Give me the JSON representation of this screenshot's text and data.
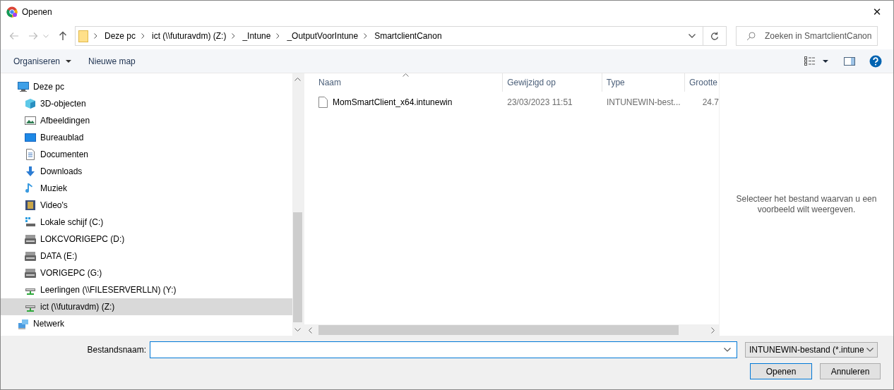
{
  "window": {
    "title": "Openen",
    "close": "✕"
  },
  "address": {
    "breadcrumbs": [
      "Deze pc",
      "ict (\\\\futuravdm) (Z:)",
      "_Intune",
      "_OutputVoorIntune",
      "SmartclientCanon"
    ]
  },
  "search": {
    "placeholder": "Zoeken in SmartclientCanon"
  },
  "toolbar": {
    "items": [
      "Organiseren",
      "Nieuwe map"
    ]
  },
  "navigation": [
    {
      "label": "Deze pc",
      "kind": "pc",
      "selected": false,
      "children": [
        {
          "label": "3D-objecten",
          "kind": "cube",
          "selected": false
        },
        {
          "label": "Afbeeldingen",
          "kind": "images",
          "selected": false
        },
        {
          "label": "Bureaublad",
          "kind": "desktop",
          "selected": false
        },
        {
          "label": "Documenten",
          "kind": "document",
          "selected": false
        },
        {
          "label": "Downloads",
          "kind": "download",
          "selected": false
        },
        {
          "label": "Muziek",
          "kind": "music",
          "selected": false
        },
        {
          "label": "Video's",
          "kind": "video",
          "selected": false
        },
        {
          "label": "Lokale schijf (C:)",
          "kind": "system-drive",
          "selected": false
        },
        {
          "label": "LOKCVORIGEPC (D:)",
          "kind": "drive",
          "selected": false
        },
        {
          "label": "DATA (E:)",
          "kind": "drive",
          "selected": false
        },
        {
          "label": "VORIGEPC (G:)",
          "kind": "drive",
          "selected": false
        },
        {
          "label": "Leerlingen (\\\\FILESERVERLLN) (Y:)",
          "kind": "network-drive",
          "selected": false
        },
        {
          "label": "ict (\\\\futuravdm) (Z:)",
          "kind": "network-drive",
          "selected": true
        }
      ]
    },
    {
      "label": "Netwerk",
      "kind": "network",
      "selected": false
    }
  ],
  "file_list": {
    "columns": [
      "Naam",
      "Gewijzigd op",
      "Type",
      "Grootte"
    ],
    "rows": [
      {
        "name": "MomSmartClient_x64.intunewin",
        "modified": "23/03/2023 11:51",
        "type": "INTUNEWIN-best...",
        "size": "24.7",
        "selected": false
      }
    ]
  },
  "preview": {
    "message": "Selecteer het bestand waarvan u een voorbeeld wilt weergeven."
  },
  "bottom": {
    "filename_label": "Bestandsnaam:",
    "filetype": "INTUNEWIN-bestand (*.intune",
    "buttons": [
      "Openen",
      "Annuleren"
    ]
  }
}
